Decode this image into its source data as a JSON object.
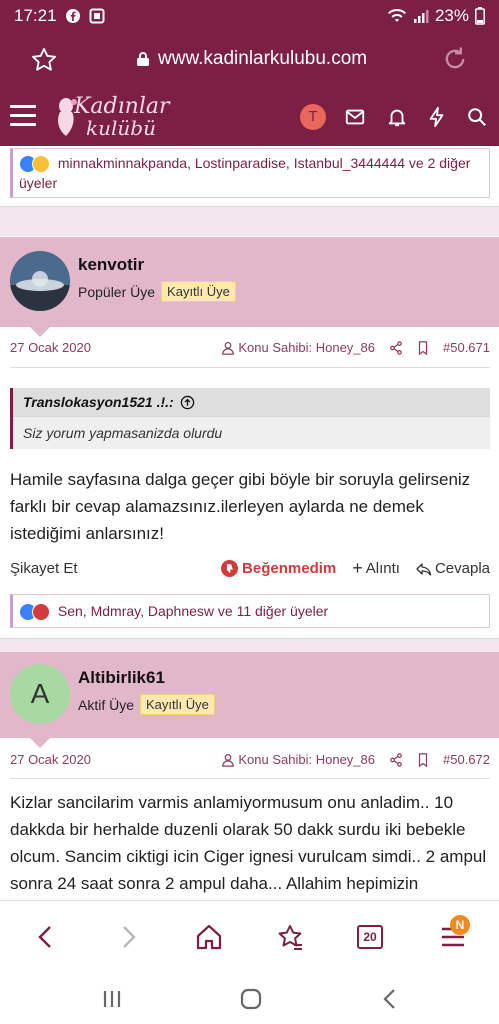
{
  "status_bar": {
    "time": "17:21",
    "battery": "23%"
  },
  "browser": {
    "url": "www.kadinlarkulubu.com",
    "tab_count": "20",
    "menu_badge": "N"
  },
  "site": {
    "logo_line1": "Kadınlar",
    "logo_line2": "kulübü",
    "user_initial": "T"
  },
  "prev_reactions": {
    "text": "minnakminnakpanda, Lostinparadise, Istanbul_3444444 ve 2 diğer üyeler"
  },
  "posts": [
    {
      "username": "kenvotir",
      "role": "Popüler Üye",
      "badge": "Kayıtlı Üye",
      "date": "27 Ocak 2020",
      "owner": "Konu Sahibi: Honey_86",
      "post_no": "#50.671",
      "quote_author": "Translokasyon1521 .!.:",
      "quote_text": "Siz yorum yapmasanizda olurdu",
      "body": "Hamile sayfasına dalga geçer gibi böyle bir soruyla gelirseniz farklı bir cevap alamazsınız.ilerleyen aylarda ne demek istediğimi anlarsınız!",
      "report": "Şikayet Et",
      "dislike": "Beğenmedim",
      "quote_action": "Alıntı",
      "reply": "Cevapla",
      "reactions": "Sen, Mdmray, Daphnesw ve 11 diğer üyeler"
    },
    {
      "username": "Altibirlik61",
      "avatar_letter": "A",
      "role": "Aktif Üye",
      "badge": "Kayıtlı Üye",
      "date": "27 Ocak 2020",
      "owner": "Konu Sahibi: Honey_86",
      "post_no": "#50.672",
      "body": "Kizlar sancilarim varmis anlamiyormusum onu anladim.. 10 dakkda bir herhalde duzenli olarak 50 dakk surdu iki bebekle olcum. Sancim ciktigi icin Ciger ignesi vurulcam simdi.. 2 ampul sonra 24 saat sonra 2 ampul daha... Allahim hepimizin yardimcisi olsun... iyiki pazartesi geldim"
    }
  ],
  "colors": {
    "brand": "#7b1f45",
    "user_block": "#e2b7c9",
    "badge": "#fde9b0",
    "dislike": "#d23b3b"
  }
}
